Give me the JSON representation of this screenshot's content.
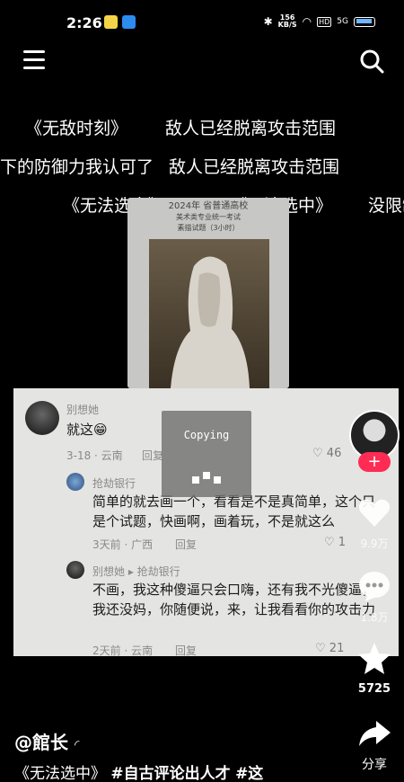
{
  "status": {
    "time": "2:26",
    "speed_top": "156",
    "speed_unit": "KB/S",
    "network": "5G",
    "hd": "HD"
  },
  "danmaku": [
    "《无敌时刻》",
    "敌人已经脱离攻击范围",
    "下的防御力我认可了",
    "敌人已经脱离攻击范围",
    "《无法选中》",
    "《无法选中》",
    "没限制"
  ],
  "video_card": {
    "line1": "2024年 省普通高校",
    "line2": "美术类专业统一考试",
    "line3": "素描试题（3小时）"
  },
  "comments": [
    {
      "name": "别想她",
      "text": "就这😁",
      "meta": "3-18 · 云南",
      "reply": "回复",
      "likes": "46"
    },
    {
      "name": "抢劫银行",
      "text": "简单的就去画一个，看看是不是真简单，这个只是个试题，快画啊，画着玩，不是就这么",
      "meta": "3天前 · 广西",
      "reply": "回复",
      "likes": "1"
    },
    {
      "name": "别想她 ▸ 抢劫银行",
      "text": "不画，我这种傻逼只会口嗨，还有我不光傻逼，我还没妈，你随便说，来，让我看看你的攻击力",
      "meta": "2天前 · 云南",
      "reply": "回复",
      "likes": "21"
    }
  ],
  "copy_overlay": {
    "label": "Copying"
  },
  "rail": {
    "likes": "9.9万",
    "comments": "1.8万",
    "favorites": "5725",
    "share": "分享"
  },
  "author": "@館长",
  "caption": {
    "text": "《无法选中》",
    "tag1": "#自古评论出人才",
    "tag2": "#这"
  }
}
